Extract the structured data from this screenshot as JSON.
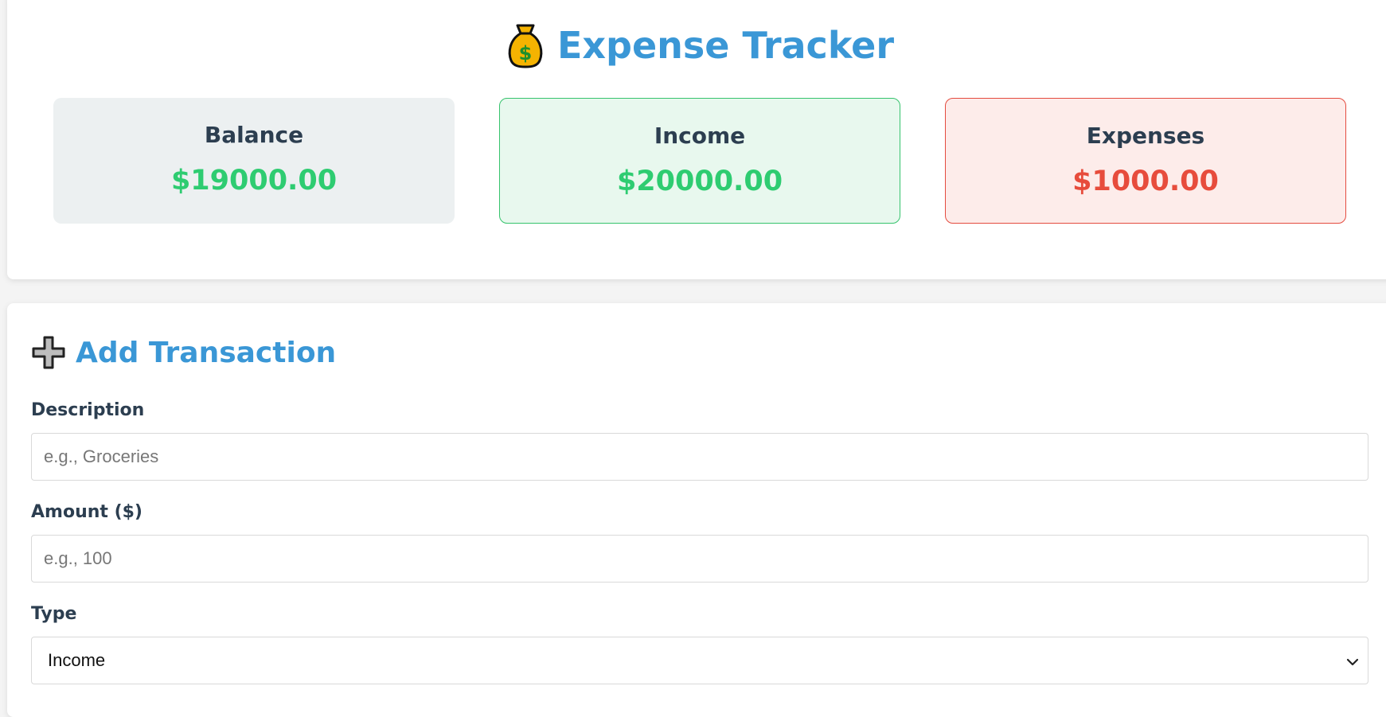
{
  "app": {
    "title": "Expense Tracker",
    "icon": "money-bag-icon"
  },
  "summary": {
    "balance": {
      "label": "Balance",
      "value": "$19000.00"
    },
    "income": {
      "label": "Income",
      "value": "$20000.00"
    },
    "expenses": {
      "label": "Expenses",
      "value": "$1000.00"
    }
  },
  "form": {
    "title": "Add Transaction",
    "icon": "plus-icon",
    "description": {
      "label": "Description",
      "placeholder": "e.g., Groceries",
      "value": ""
    },
    "amount": {
      "label": "Amount ($)",
      "placeholder": "e.g., 100",
      "value": ""
    },
    "type": {
      "label": "Type",
      "selected": "Income"
    }
  },
  "colors": {
    "accent": "#3a97d6",
    "positive": "#2ecc71",
    "negative": "#e74c3c",
    "text": "#2c3e50"
  }
}
